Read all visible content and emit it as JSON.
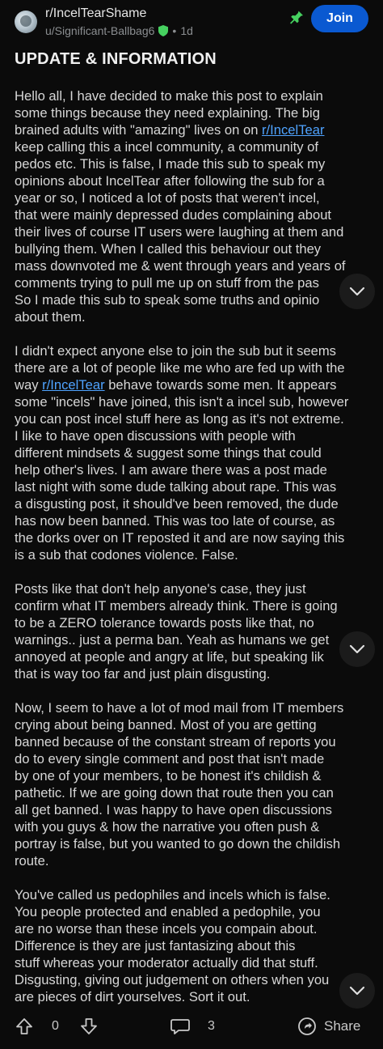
{
  "header": {
    "subreddit": "r/IncelTearShame",
    "author": "u/Significant-Ballbag6",
    "age": "1d",
    "separator": "•",
    "join_label": "Join"
  },
  "post": {
    "title": "UPDATE & INFORMATION",
    "paragraphs": [
      {
        "lines": [
          [
            "Hello all, I have decided to make this post to explain"
          ],
          [
            "some things because they need explaining. The big"
          ],
          [
            "brained adults with \"amazing\" lives on on ",
            {
              "link": "r/IncelTear"
            }
          ],
          [
            "keep calling this a incel community, a community of"
          ],
          [
            "pedos etc. This is false, I made this sub to speak my"
          ],
          [
            "opinions about IncelTear after following the sub for a"
          ],
          [
            "year or so, I noticed a lot of posts that weren't incel,"
          ],
          [
            "that were mainly depressed dudes complaining about"
          ],
          [
            "their lives of course IT users were laughing at them and"
          ],
          [
            "bullying them. When I called this behaviour out they"
          ],
          [
            "mass downvoted me & went through years and years of"
          ],
          [
            "comments trying to pull me up on stuff from the pas"
          ],
          [
            "So I made this sub to speak some truths and opinio"
          ],
          [
            "about them."
          ]
        ]
      },
      {
        "lines": [
          [
            "I didn't expect anyone else to join the sub but it seems"
          ],
          [
            "there are a lot of people like me who are fed up with the"
          ],
          [
            "way ",
            {
              "link": "r/IncelTear"
            },
            " behave towards some men. It appears"
          ],
          [
            "some \"incels\" have joined, this isn't a incel sub, however"
          ],
          [
            "you can post incel stuff here as long as it's not extreme."
          ],
          [
            "I like to have open discussions with people with"
          ],
          [
            "different mindsets & suggest some things that could"
          ],
          [
            "help other's lives. I am aware there was a post made"
          ],
          [
            "last night with some dude talking about rape. This was"
          ],
          [
            "a disgusting post, it should've been removed, the dude"
          ],
          [
            "has now been banned. This was too late of course, as"
          ],
          [
            "the dorks over on IT reposted it and are now saying this"
          ],
          [
            "is a sub that codones violence. False."
          ]
        ]
      },
      {
        "lines": [
          [
            "Posts like that don't help anyone's case, they just"
          ],
          [
            "confirm what IT members already think. There is going"
          ],
          [
            "to be a ZERO tolerance towards posts like that, no"
          ],
          [
            "warnings.. just a perma ban. Yeah as humans we get"
          ],
          [
            "annoyed at people and angry at life, but speaking lik"
          ],
          [
            "that is way too far and just plain disgusting."
          ]
        ]
      },
      {
        "lines": [
          [
            "Now, I seem to have a lot of mod mail from IT members"
          ],
          [
            "crying about being banned. Most of you are getting"
          ],
          [
            "banned because of the constant stream of reports you"
          ],
          [
            "do to every single comment and post that isn't made"
          ],
          [
            "by one of your members, to be honest it's childish &"
          ],
          [
            "pathetic. If we are going down that route then you can"
          ],
          [
            "all get banned. I was happy to have open discussions"
          ],
          [
            "with you guys & how the narrative you often push &"
          ],
          [
            "portray is false, but you wanted to go down the childish"
          ],
          [
            "route."
          ]
        ]
      },
      {
        "lines": [
          [
            "You've called us pedophiles and incels which is false."
          ],
          [
            "You people protected and enabled a pedophile, you"
          ],
          [
            "are no worse than these incels you compain about."
          ],
          [
            "Difference is they are just fantasizing about this"
          ],
          [
            "stuff whereas your moderator actually did that stuff."
          ],
          [
            "Disgusting, giving out judgement on others when you"
          ],
          [
            "are pieces of dirt yourselves. Sort it out."
          ]
        ]
      }
    ]
  },
  "footer": {
    "vote_count": "0",
    "comment_count": "3",
    "share_label": "Share"
  },
  "icons": {
    "upvote": "upvote-icon",
    "downvote": "downvote-icon",
    "comment": "comment-icon",
    "share": "share-icon",
    "pin": "pin-icon",
    "mod_shield": "mod-shield-icon",
    "scroll_down": "chevron-down-icon"
  },
  "colors": {
    "background": "#0b0b0b",
    "join_button": "#0a59d1",
    "link": "#4fa3ff",
    "mod_green": "#46d160"
  }
}
